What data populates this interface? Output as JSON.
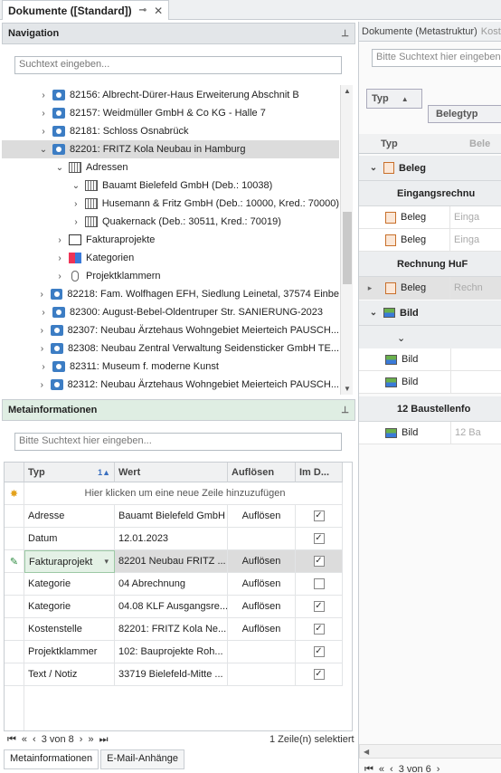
{
  "tab": {
    "title": "Dokumente ([Standard])",
    "pin": "⊸",
    "close": "✕"
  },
  "navigation": {
    "title": "Navigation",
    "search_placeholder": "Suchtext eingeben...",
    "tree": [
      {
        "label": "82156: Albrecht-Dürer-Haus Erweiterung Abschnit B",
        "indent": 0,
        "icon": "document-icon",
        "chev": "›"
      },
      {
        "label": "82157: Weidmüller GmbH & Co KG - Halle 7",
        "indent": 0,
        "icon": "document-icon",
        "chev": "›"
      },
      {
        "label": "82181: Schloss Osnabrück",
        "indent": 0,
        "icon": "document-icon",
        "chev": "›"
      },
      {
        "label": "82201: FRITZ Kola Neubau in Hamburg",
        "indent": 0,
        "icon": "document-icon",
        "chev": "⌄",
        "selected": true
      },
      {
        "label": "Adressen",
        "indent": 1,
        "icon": "building-icon",
        "chev": "⌄"
      },
      {
        "label": "Bauamt Bielefeld GmbH (Deb.: 10038)",
        "indent": 2,
        "icon": "building-icon",
        "chev": "⌄"
      },
      {
        "label": "Husemann & Fritz GmbH (Deb.: 10000, Kred.: 70000)",
        "indent": 2,
        "icon": "building-icon",
        "chev": "›"
      },
      {
        "label": "Quakernack (Deb.: 30511, Kred.: 70019)",
        "indent": 2,
        "icon": "building-icon",
        "chev": "›"
      },
      {
        "label": "Fakturaprojekte",
        "indent": 1,
        "icon": "invoice-icon",
        "chev": "›"
      },
      {
        "label": "Kategorien",
        "indent": 1,
        "icon": "category-icon",
        "chev": "›"
      },
      {
        "label": "Projektklammern",
        "indent": 1,
        "icon": "paperclip-icon",
        "chev": "›"
      },
      {
        "label": "82218: Fam. Wolfhagen EFH, Siedlung Leinetal, 37574 Einbe",
        "indent": 0,
        "icon": "document-icon",
        "chev": "›"
      },
      {
        "label": "82300: August-Bebel-Oldentruper Str. SANIERUNG-2023",
        "indent": 0,
        "icon": "document-icon",
        "chev": "›"
      },
      {
        "label": "82307: Neubau Ärztehaus Wohngebiet Meierteich PAUSCH...",
        "indent": 0,
        "icon": "document-icon",
        "chev": "›"
      },
      {
        "label": "82308: Neubau Zentral Verwaltung Seidensticker GmbH TE...",
        "indent": 0,
        "icon": "document-icon",
        "chev": "›"
      },
      {
        "label": "82311: Museum f. moderne Kunst",
        "indent": 0,
        "icon": "document-icon",
        "chev": "›"
      },
      {
        "label": "82312: Neubau Ärztehaus Wohngebiet Meierteich PAUSCH...",
        "indent": 0,
        "icon": "document-icon",
        "chev": "›"
      }
    ]
  },
  "meta": {
    "title": "Metainformationen",
    "search_placeholder": "Bitte Suchtext hier eingeben...",
    "columns": {
      "typ": "Typ",
      "sort": "1▲",
      "wert": "Wert",
      "aufloesen": "Auflösen",
      "imd": "Im D..."
    },
    "new_row": "Hier klicken um eine neue Zeile hinzuzufügen",
    "rows": [
      {
        "typ": "Adresse",
        "wert": "Bauamt Bielefeld GmbH",
        "aufloesen": "Auflösen",
        "checked": true
      },
      {
        "typ": "Datum",
        "wert": "12.01.2023",
        "aufloesen": "",
        "checked": true
      },
      {
        "typ": "Fakturaprojekt",
        "wert": "82201 Neubau FRITZ ...",
        "aufloesen": "Auflösen",
        "checked": true,
        "active": true
      },
      {
        "typ": "Kategorie",
        "wert": "04 Abrechnung",
        "aufloesen": "Auflösen",
        "checked": false
      },
      {
        "typ": "Kategorie",
        "wert": "04.08 KLF Ausgangsre...",
        "aufloesen": "Auflösen",
        "checked": true
      },
      {
        "typ": "Kostenstelle",
        "wert": "82201: FRITZ Kola Ne...",
        "aufloesen": "Auflösen",
        "checked": true
      },
      {
        "typ": "Projektklammer",
        "wert": "102: Bauprojekte Roh...",
        "aufloesen": "",
        "checked": true
      },
      {
        "typ": "Text / Notiz",
        "wert": "33719 Bielefeld-Mitte ...",
        "aufloesen": "",
        "checked": true
      }
    ],
    "pager": "3 von 8",
    "status": "1 Zeile(n) selektiert"
  },
  "bottom_tabs": [
    "Metainformationen",
    "E-Mail-Anhänge"
  ],
  "right": {
    "tab": "Dokumente (Metastruktur)",
    "tab2": "Kost",
    "search_placeholder": "Bitte Suchtext hier eingeben",
    "group_chip": "Typ",
    "group_chip2": "Belegtyp",
    "col_typ": "Typ",
    "col_bele": "Bele",
    "rows": [
      {
        "kind": "group1",
        "label": "Beleg",
        "icon": "beleg"
      },
      {
        "kind": "group2",
        "label": "Eingangsrechnu"
      },
      {
        "kind": "item",
        "label": "Beleg",
        "sub": "Einga",
        "icon": "beleg"
      },
      {
        "kind": "item",
        "label": "Beleg",
        "sub": "Einga",
        "icon": "beleg"
      },
      {
        "kind": "group2",
        "label": "Rechnung HuF"
      },
      {
        "kind": "item",
        "label": "Beleg",
        "sub": "Rechn",
        "icon": "beleg",
        "active": true
      },
      {
        "kind": "group1",
        "label": "Bild",
        "icon": "bild"
      },
      {
        "kind": "group2",
        "label": ""
      },
      {
        "kind": "item",
        "label": "Bild",
        "sub": "",
        "icon": "bild"
      },
      {
        "kind": "item",
        "label": "Bild",
        "sub": "",
        "icon": "bild"
      },
      {
        "kind": "group2",
        "label": "12 Baustellenfo"
      },
      {
        "kind": "item",
        "label": "Bild",
        "sub": "12 Ba",
        "icon": "bild"
      }
    ],
    "pager": "3 von 6"
  }
}
